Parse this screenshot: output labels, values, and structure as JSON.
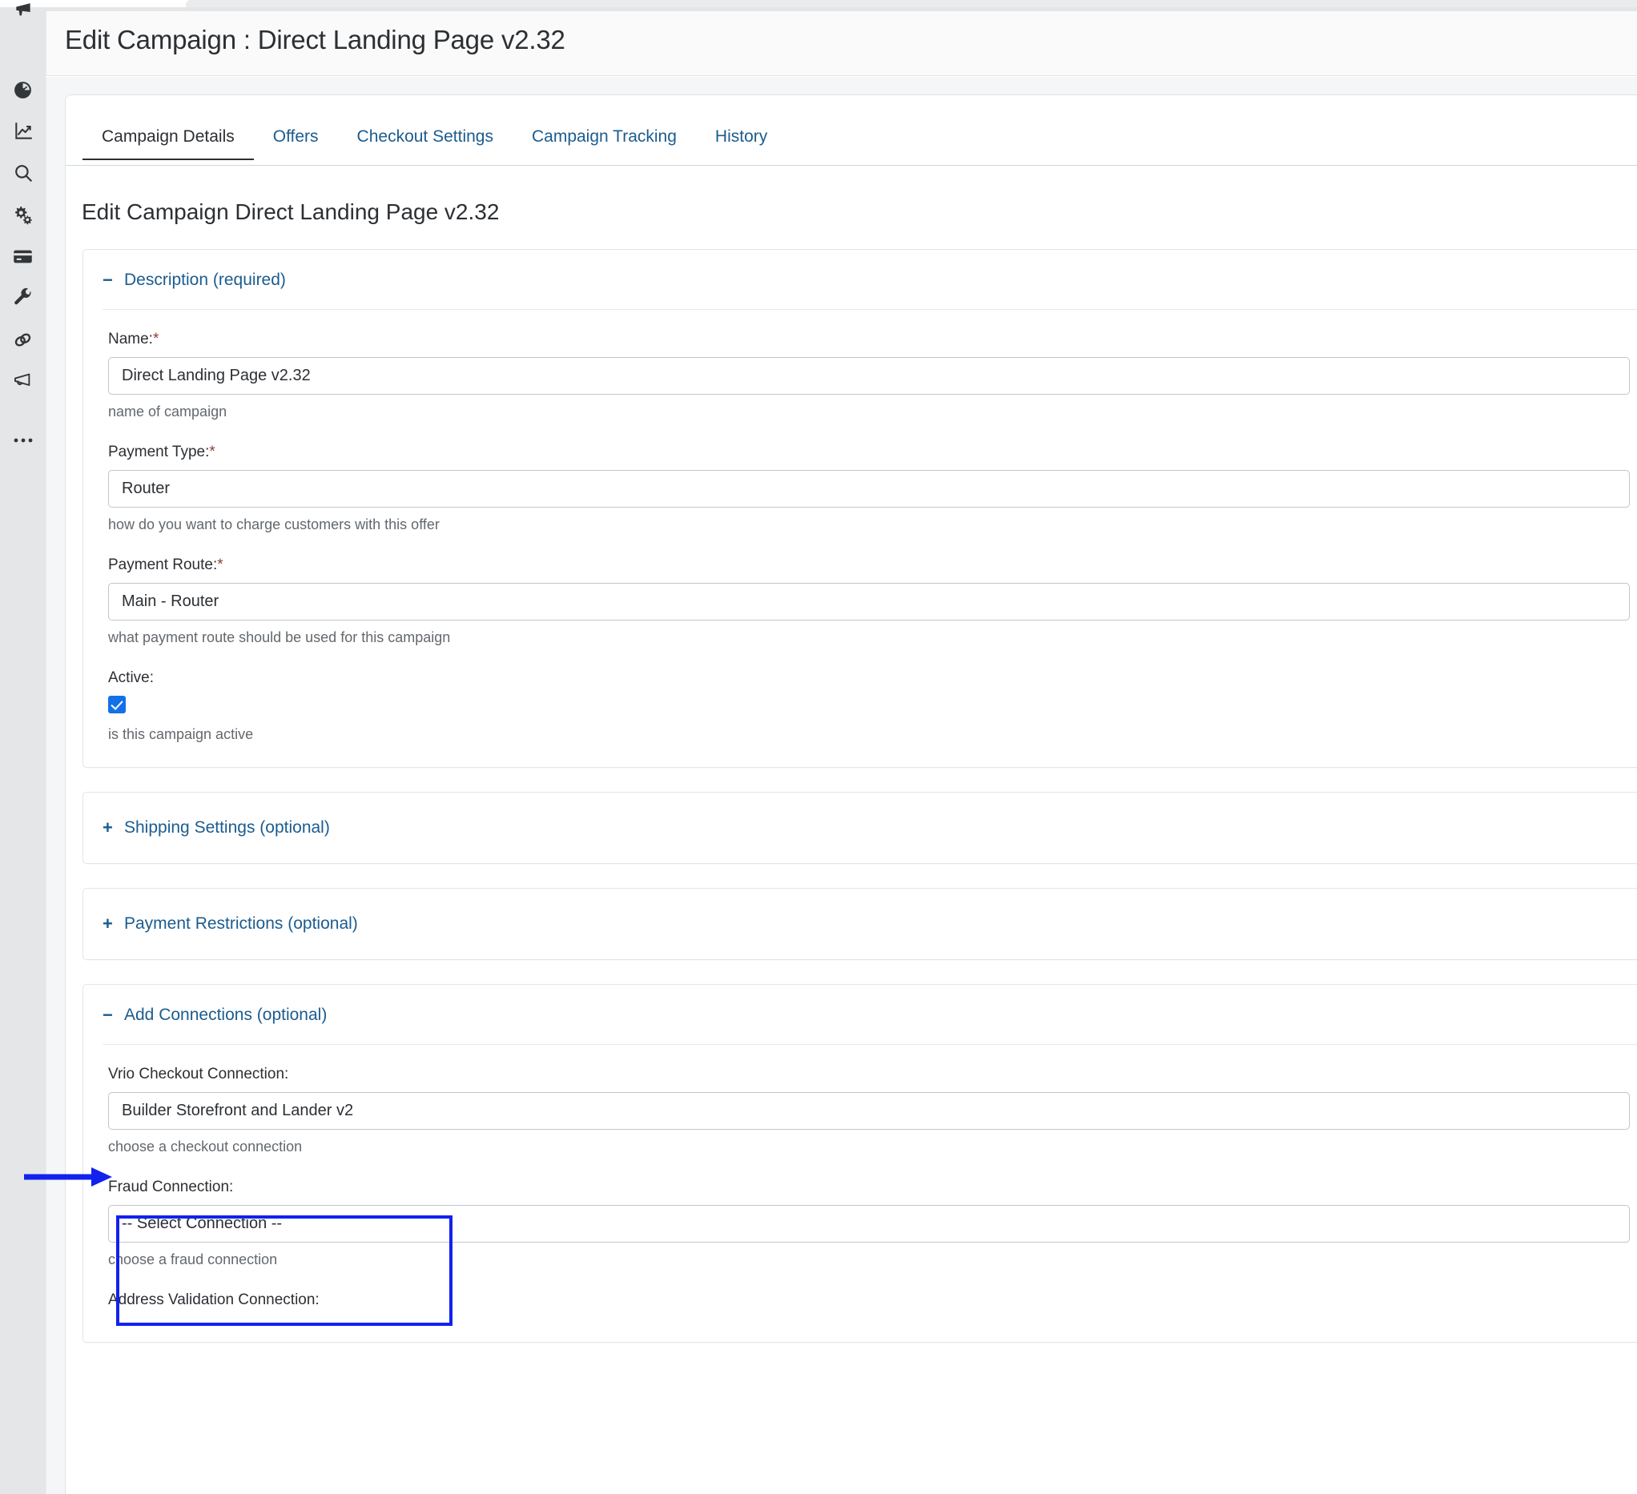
{
  "header": {
    "title": "Edit Campaign : Direct Landing Page v2.32"
  },
  "sidebar": {
    "items": [
      {
        "icon": "megaphone-filled-icon",
        "name": "sidebar-item-announcements"
      },
      {
        "icon": "dashboard-gauge-icon",
        "name": "sidebar-item-dashboard"
      },
      {
        "icon": "line-chart-icon",
        "name": "sidebar-item-analytics"
      },
      {
        "icon": "search-icon",
        "name": "sidebar-item-search"
      },
      {
        "icon": "gears-icon",
        "name": "sidebar-item-settings"
      },
      {
        "icon": "credit-card-icon",
        "name": "sidebar-item-billing"
      },
      {
        "icon": "wrench-icon",
        "name": "sidebar-item-tools"
      },
      {
        "icon": "link-chain-icon",
        "name": "sidebar-item-connections"
      },
      {
        "icon": "megaphone-outline-icon",
        "name": "sidebar-item-campaigns"
      },
      {
        "icon": "ellipsis-icon",
        "name": "sidebar-item-more"
      }
    ]
  },
  "tabs": [
    {
      "label": "Campaign Details",
      "active": true
    },
    {
      "label": "Offers",
      "active": false
    },
    {
      "label": "Checkout Settings",
      "active": false
    },
    {
      "label": "Campaign Tracking",
      "active": false
    },
    {
      "label": "History",
      "active": false
    }
  ],
  "main": {
    "section_heading": "Edit Campaign Direct Landing Page v2.32"
  },
  "panels": {
    "description": {
      "toggle": "−",
      "title": "Description (required)",
      "fields": {
        "name": {
          "label": "Name:",
          "required": "*",
          "value": "Direct Landing Page v2.32",
          "help": "name of campaign"
        },
        "payment_type": {
          "label": "Payment Type:",
          "required": "*",
          "value": "Router",
          "help": "how do you want to charge customers with this offer"
        },
        "payment_route": {
          "label": "Payment Route:",
          "required": "*",
          "value": "Main - Router",
          "help": "what payment route should be used for this campaign"
        },
        "active": {
          "label": "Active:",
          "checked": true,
          "help": "is this campaign active"
        }
      }
    },
    "shipping": {
      "toggle": "+",
      "title": "Shipping Settings (optional)"
    },
    "payment_restrictions": {
      "toggle": "+",
      "title": "Payment Restrictions (optional)"
    },
    "add_connections": {
      "toggle": "−",
      "title": "Add Connections (optional)",
      "fields": {
        "vrio_checkout": {
          "label": "Vrio Checkout Connection:",
          "value": "Builder Storefront and Lander v2",
          "help": "choose a checkout connection"
        },
        "fraud": {
          "label": "Fraud Connection:",
          "value": "-- Select Connection --",
          "help": "choose a fraud connection"
        },
        "address_validation": {
          "label": "Address Validation Connection:"
        }
      }
    }
  },
  "annotations": {
    "arrow_color": "#1122ee",
    "highlight_color": "#1122ee"
  },
  "colors": {
    "link_blue": "#1b5c8f",
    "required_red": "#9c3636",
    "checkbox_blue": "#1271e8",
    "page_bg": "#f5f6f7",
    "rail_bg": "#e5e6e7"
  }
}
